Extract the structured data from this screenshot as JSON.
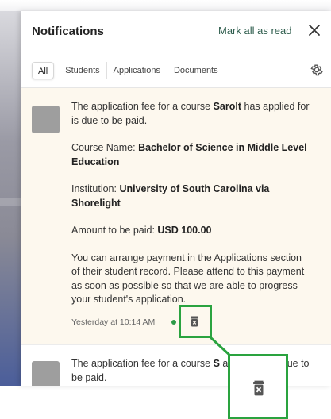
{
  "header": {
    "title": "Notifications",
    "mark_all_read": "Mark all as read"
  },
  "tabs": [
    {
      "label": "All",
      "active": true
    },
    {
      "label": "Students",
      "active": false
    },
    {
      "label": "Applications",
      "active": false
    },
    {
      "label": "Documents",
      "active": false
    }
  ],
  "notifications": [
    {
      "intro_prefix": "The application fee for a course ",
      "intro_name": "Sarolt",
      "intro_suffix": " has applied for is due to be paid.",
      "course_label": "Course Name: ",
      "course_value": "Bachelor of Science in Middle Level Education",
      "institution_label": "Institution: ",
      "institution_value": "University of South Carolina via Shorelight",
      "amount_label": "Amount to be paid: ",
      "amount_value": "USD 100.00",
      "message": "You can arrange payment in the Applications section of their student record. Please attend to this payment as soon as possible so that we are able to progress your student's application.",
      "timestamp": "Yesterday at 10:14 AM",
      "unread": true
    },
    {
      "intro_prefix": "The application fee for a course ",
      "intro_name": "S",
      "intro_suffix": " applied for is due to be paid."
    }
  ],
  "colors": {
    "accent_green": "#2e5d4d",
    "highlight_green": "#2aa33f",
    "unread_dot": "#2e9a48",
    "notification_bg": "#fdf8ee"
  },
  "icons": {
    "close": "close-icon",
    "settings": "gear-icon",
    "delete": "trash-icon"
  }
}
